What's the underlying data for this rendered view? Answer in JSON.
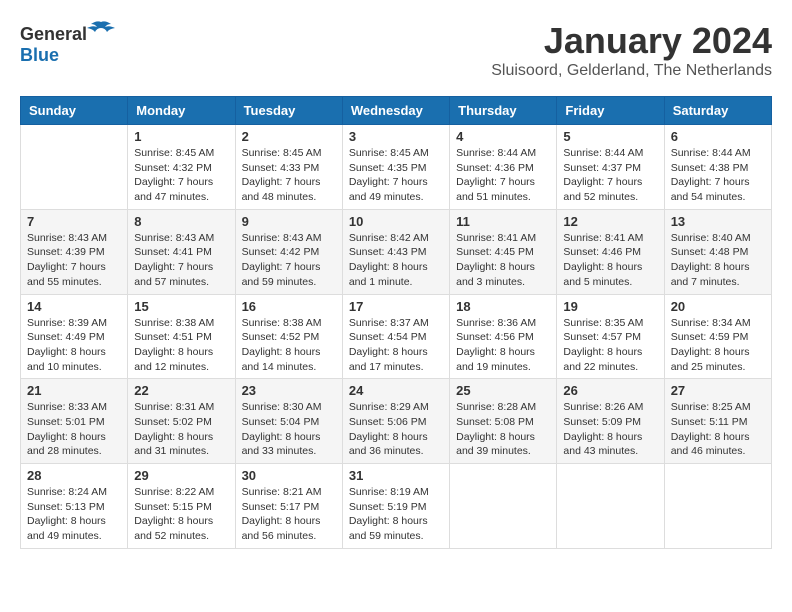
{
  "logo": {
    "general": "General",
    "blue": "Blue"
  },
  "header": {
    "month": "January 2024",
    "location": "Sluisoord, Gelderland, The Netherlands"
  },
  "weekdays": [
    "Sunday",
    "Monday",
    "Tuesday",
    "Wednesday",
    "Thursday",
    "Friday",
    "Saturday"
  ],
  "weeks": [
    [
      {
        "day": "",
        "sunrise": "",
        "sunset": "",
        "daylight": ""
      },
      {
        "day": "1",
        "sunrise": "Sunrise: 8:45 AM",
        "sunset": "Sunset: 4:32 PM",
        "daylight": "Daylight: 7 hours and 47 minutes."
      },
      {
        "day": "2",
        "sunrise": "Sunrise: 8:45 AM",
        "sunset": "Sunset: 4:33 PM",
        "daylight": "Daylight: 7 hours and 48 minutes."
      },
      {
        "day": "3",
        "sunrise": "Sunrise: 8:45 AM",
        "sunset": "Sunset: 4:35 PM",
        "daylight": "Daylight: 7 hours and 49 minutes."
      },
      {
        "day": "4",
        "sunrise": "Sunrise: 8:44 AM",
        "sunset": "Sunset: 4:36 PM",
        "daylight": "Daylight: 7 hours and 51 minutes."
      },
      {
        "day": "5",
        "sunrise": "Sunrise: 8:44 AM",
        "sunset": "Sunset: 4:37 PM",
        "daylight": "Daylight: 7 hours and 52 minutes."
      },
      {
        "day": "6",
        "sunrise": "Sunrise: 8:44 AM",
        "sunset": "Sunset: 4:38 PM",
        "daylight": "Daylight: 7 hours and 54 minutes."
      }
    ],
    [
      {
        "day": "7",
        "sunrise": "Sunrise: 8:43 AM",
        "sunset": "Sunset: 4:39 PM",
        "daylight": "Daylight: 7 hours and 55 minutes."
      },
      {
        "day": "8",
        "sunrise": "Sunrise: 8:43 AM",
        "sunset": "Sunset: 4:41 PM",
        "daylight": "Daylight: 7 hours and 57 minutes."
      },
      {
        "day": "9",
        "sunrise": "Sunrise: 8:43 AM",
        "sunset": "Sunset: 4:42 PM",
        "daylight": "Daylight: 7 hours and 59 minutes."
      },
      {
        "day": "10",
        "sunrise": "Sunrise: 8:42 AM",
        "sunset": "Sunset: 4:43 PM",
        "daylight": "Daylight: 8 hours and 1 minute."
      },
      {
        "day": "11",
        "sunrise": "Sunrise: 8:41 AM",
        "sunset": "Sunset: 4:45 PM",
        "daylight": "Daylight: 8 hours and 3 minutes."
      },
      {
        "day": "12",
        "sunrise": "Sunrise: 8:41 AM",
        "sunset": "Sunset: 4:46 PM",
        "daylight": "Daylight: 8 hours and 5 minutes."
      },
      {
        "day": "13",
        "sunrise": "Sunrise: 8:40 AM",
        "sunset": "Sunset: 4:48 PM",
        "daylight": "Daylight: 8 hours and 7 minutes."
      }
    ],
    [
      {
        "day": "14",
        "sunrise": "Sunrise: 8:39 AM",
        "sunset": "Sunset: 4:49 PM",
        "daylight": "Daylight: 8 hours and 10 minutes."
      },
      {
        "day": "15",
        "sunrise": "Sunrise: 8:38 AM",
        "sunset": "Sunset: 4:51 PM",
        "daylight": "Daylight: 8 hours and 12 minutes."
      },
      {
        "day": "16",
        "sunrise": "Sunrise: 8:38 AM",
        "sunset": "Sunset: 4:52 PM",
        "daylight": "Daylight: 8 hours and 14 minutes."
      },
      {
        "day": "17",
        "sunrise": "Sunrise: 8:37 AM",
        "sunset": "Sunset: 4:54 PM",
        "daylight": "Daylight: 8 hours and 17 minutes."
      },
      {
        "day": "18",
        "sunrise": "Sunrise: 8:36 AM",
        "sunset": "Sunset: 4:56 PM",
        "daylight": "Daylight: 8 hours and 19 minutes."
      },
      {
        "day": "19",
        "sunrise": "Sunrise: 8:35 AM",
        "sunset": "Sunset: 4:57 PM",
        "daylight": "Daylight: 8 hours and 22 minutes."
      },
      {
        "day": "20",
        "sunrise": "Sunrise: 8:34 AM",
        "sunset": "Sunset: 4:59 PM",
        "daylight": "Daylight: 8 hours and 25 minutes."
      }
    ],
    [
      {
        "day": "21",
        "sunrise": "Sunrise: 8:33 AM",
        "sunset": "Sunset: 5:01 PM",
        "daylight": "Daylight: 8 hours and 28 minutes."
      },
      {
        "day": "22",
        "sunrise": "Sunrise: 8:31 AM",
        "sunset": "Sunset: 5:02 PM",
        "daylight": "Daylight: 8 hours and 31 minutes."
      },
      {
        "day": "23",
        "sunrise": "Sunrise: 8:30 AM",
        "sunset": "Sunset: 5:04 PM",
        "daylight": "Daylight: 8 hours and 33 minutes."
      },
      {
        "day": "24",
        "sunrise": "Sunrise: 8:29 AM",
        "sunset": "Sunset: 5:06 PM",
        "daylight": "Daylight: 8 hours and 36 minutes."
      },
      {
        "day": "25",
        "sunrise": "Sunrise: 8:28 AM",
        "sunset": "Sunset: 5:08 PM",
        "daylight": "Daylight: 8 hours and 39 minutes."
      },
      {
        "day": "26",
        "sunrise": "Sunrise: 8:26 AM",
        "sunset": "Sunset: 5:09 PM",
        "daylight": "Daylight: 8 hours and 43 minutes."
      },
      {
        "day": "27",
        "sunrise": "Sunrise: 8:25 AM",
        "sunset": "Sunset: 5:11 PM",
        "daylight": "Daylight: 8 hours and 46 minutes."
      }
    ],
    [
      {
        "day": "28",
        "sunrise": "Sunrise: 8:24 AM",
        "sunset": "Sunset: 5:13 PM",
        "daylight": "Daylight: 8 hours and 49 minutes."
      },
      {
        "day": "29",
        "sunrise": "Sunrise: 8:22 AM",
        "sunset": "Sunset: 5:15 PM",
        "daylight": "Daylight: 8 hours and 52 minutes."
      },
      {
        "day": "30",
        "sunrise": "Sunrise: 8:21 AM",
        "sunset": "Sunset: 5:17 PM",
        "daylight": "Daylight: 8 hours and 56 minutes."
      },
      {
        "day": "31",
        "sunrise": "Sunrise: 8:19 AM",
        "sunset": "Sunset: 5:19 PM",
        "daylight": "Daylight: 8 hours and 59 minutes."
      },
      {
        "day": "",
        "sunrise": "",
        "sunset": "",
        "daylight": ""
      },
      {
        "day": "",
        "sunrise": "",
        "sunset": "",
        "daylight": ""
      },
      {
        "day": "",
        "sunrise": "",
        "sunset": "",
        "daylight": ""
      }
    ]
  ]
}
